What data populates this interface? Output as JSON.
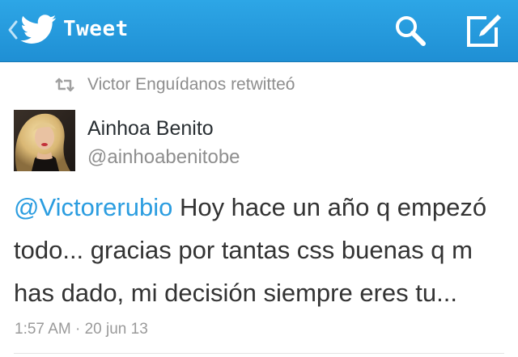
{
  "app": {
    "title": "Tweet",
    "accent_color": "#2da6e6",
    "link_color": "#2b9de0"
  },
  "actionbar": {
    "nav_icon": "twitter-bird-icon",
    "actions": [
      {
        "name": "search",
        "icon": "search-icon"
      },
      {
        "name": "compose",
        "icon": "compose-icon"
      }
    ]
  },
  "retweet": {
    "icon": "retweet-icon",
    "text": "Victor Enguídanos retwitteó"
  },
  "author": {
    "name": "Ainhoa Benito",
    "handle": "@ainhoabenitobe"
  },
  "tweet": {
    "mention": "@Victorerubio",
    "text": " Hoy hace un año q empezó todo... gracias por tantas css buenas q m has dado, mi decisión siempre eres tu..."
  },
  "meta": {
    "timestamp": "1:57 AM · 20 jun 13"
  }
}
